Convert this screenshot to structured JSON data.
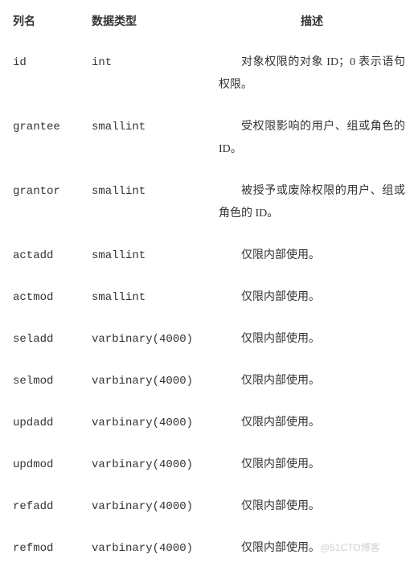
{
  "columns": {
    "name": "列名",
    "type": "数据类型",
    "desc": "描述"
  },
  "rows": [
    {
      "name": "id",
      "type": "int",
      "desc": "对象权限的对象 ID；0 表示语句权限。"
    },
    {
      "name": "grantee",
      "type": "smallint",
      "desc": "受权限影响的用户、组或角色的 ID。"
    },
    {
      "name": "grantor",
      "type": "smallint",
      "desc": "被授予或废除权限的用户、组或角色的 ID。"
    },
    {
      "name": "actadd",
      "type": "smallint",
      "desc": "仅限内部使用。"
    },
    {
      "name": "actmod",
      "type": "smallint",
      "desc": "仅限内部使用。"
    },
    {
      "name": "seladd",
      "type": "varbinary(4000)",
      "desc": "仅限内部使用。"
    },
    {
      "name": "selmod",
      "type": "varbinary(4000)",
      "desc": "仅限内部使用。"
    },
    {
      "name": "updadd",
      "type": "varbinary(4000)",
      "desc": "仅限内部使用。"
    },
    {
      "name": "updmod",
      "type": "varbinary(4000)",
      "desc": "仅限内部使用。"
    },
    {
      "name": "refadd",
      "type": "varbinary(4000)",
      "desc": "仅限内部使用。"
    },
    {
      "name": "refmod",
      "type": "varbinary(4000)",
      "desc": "仅限内部使用。",
      "watermark": "@51CTO博客"
    }
  ]
}
